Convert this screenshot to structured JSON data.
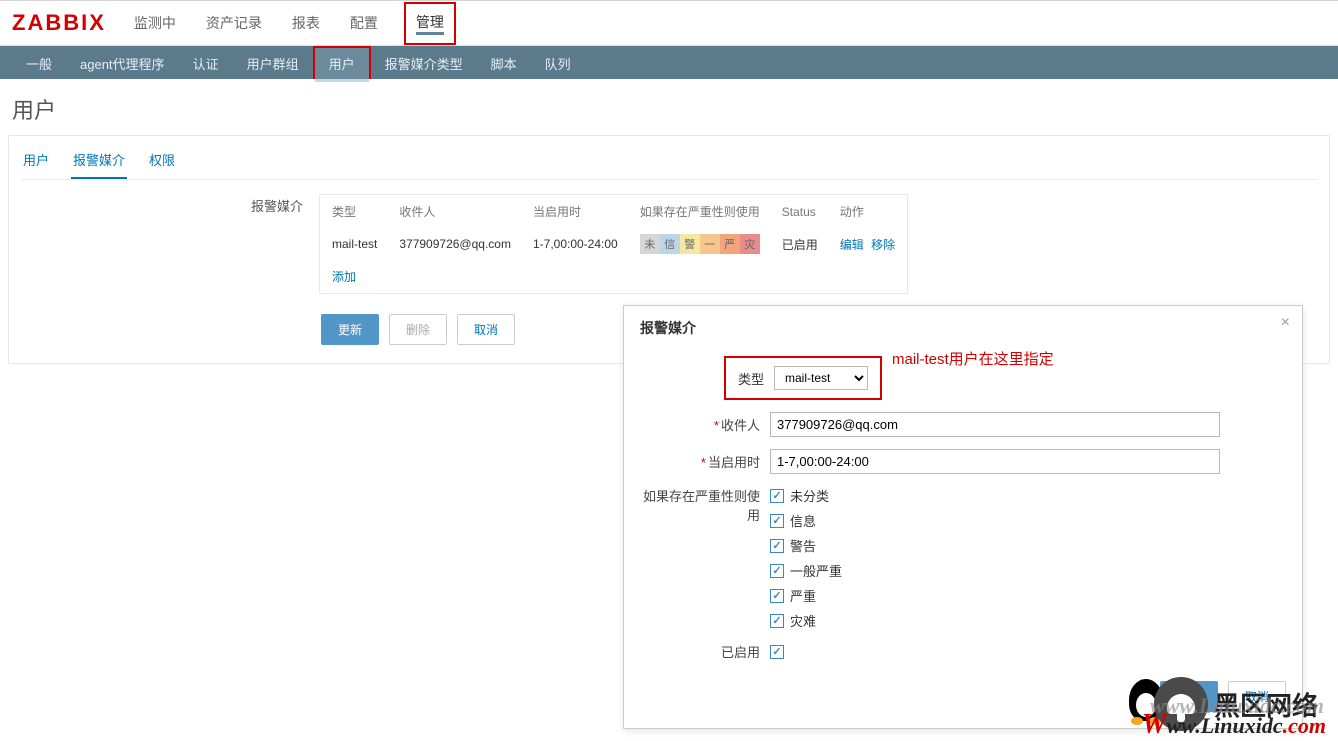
{
  "logo": "ZABBIX",
  "top_nav": {
    "items": [
      "监测中",
      "资产记录",
      "报表",
      "配置",
      "管理"
    ],
    "active_index": 4
  },
  "sub_nav": {
    "items": [
      "一般",
      "agent代理程序",
      "认证",
      "用户群组",
      "用户",
      "报警媒介类型",
      "脚本",
      "队列"
    ],
    "active_index": 4
  },
  "page_title": "用户",
  "tabs": {
    "items": [
      "用户",
      "报警媒介",
      "权限"
    ],
    "active_index": 1
  },
  "media_label": "报警媒介",
  "media_table": {
    "headers": [
      "类型",
      "收件人",
      "当启用时",
      "如果存在严重性则使用",
      "Status",
      "动作"
    ],
    "row": {
      "type": "mail-test",
      "recipient": "377909726@qq.com",
      "when": "1-7,00:00-24:00",
      "status": "已启用",
      "edit": "编辑",
      "remove": "移除"
    },
    "severity_badges": [
      {
        "label": "未",
        "bg": "#d6d6d6"
      },
      {
        "label": "信",
        "bg": "#bcd6e8"
      },
      {
        "label": "警",
        "bg": "#f5e7a0"
      },
      {
        "label": "一",
        "bg": "#f5c78f"
      },
      {
        "label": "严",
        "bg": "#f2a57a"
      },
      {
        "label": "灾",
        "bg": "#e88b8b"
      }
    ]
  },
  "add_link": "添加",
  "buttons": {
    "update": "更新",
    "delete": "删除",
    "cancel": "取消"
  },
  "dialog": {
    "title": "报警媒介",
    "annotation": "mail-test用户在这里指定",
    "fields": {
      "type_label": "类型",
      "type_value": "mail-test",
      "recipient_label": "收件人",
      "recipient_value": "377909726@qq.com",
      "when_label": "当启用时",
      "when_value": "1-7,00:00-24:00",
      "severity_label": "如果存在严重性则使用",
      "severities": [
        "未分类",
        "信息",
        "警告",
        "一般严重",
        "严重",
        "灾难"
      ],
      "enabled_label": "已启用"
    },
    "buttons": {
      "update": "更新",
      "cancel": "取消"
    }
  },
  "watermarks": {
    "wm1": "黑区网络",
    "wm2_shadow": "www.Linuxidc.com",
    "wm2_main_w": "W",
    "wm2_main_rest": "ww.Linuxidc",
    "wm2_main_dot": ".com"
  }
}
